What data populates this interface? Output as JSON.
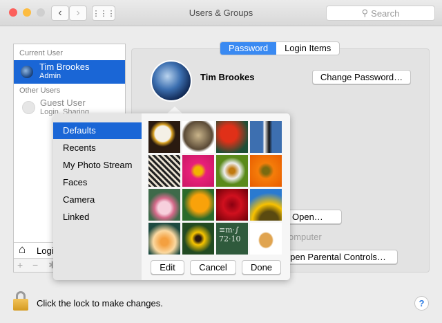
{
  "window": {
    "title": "Users & Groups",
    "search_placeholder": "Search"
  },
  "sidebar": {
    "current_header": "Current User",
    "current_name": "Tim Brookes",
    "current_role": "Admin",
    "other_header": "Other Users",
    "guest_name": "Guest User",
    "guest_detail": "Login, Sharing",
    "login_options": "Login Options",
    "add": "+",
    "remove": "−",
    "gear": "✱"
  },
  "tabs": [
    {
      "label": "Password"
    },
    {
      "label": "Login Items"
    }
  ],
  "main": {
    "user_name": "Tim Brookes",
    "change_password": "Change Password…",
    "open_button": "Open…",
    "computer_text": "omputer",
    "parental": "Open Parental Controls…"
  },
  "popover": {
    "menu": [
      "Defaults",
      "Recents",
      "My Photo Stream",
      "Faces",
      "Camera",
      "Linked"
    ],
    "selected": "Defaults",
    "edit": "Edit",
    "cancel": "Cancel",
    "done": "Done",
    "tiles": [
      "eagle",
      "owl",
      "parrot",
      "penguin",
      "zebra",
      "pink-dahlia",
      "dandelion",
      "orange-gerbera",
      "lotus",
      "poppy",
      "red-rose",
      "sunflower",
      "yellow-rose",
      "black-eyed-susan",
      "chalkboard",
      "fortune-cookie"
    ]
  },
  "footer": {
    "lock_text": "Click the lock to make changes.",
    "help": "?"
  }
}
